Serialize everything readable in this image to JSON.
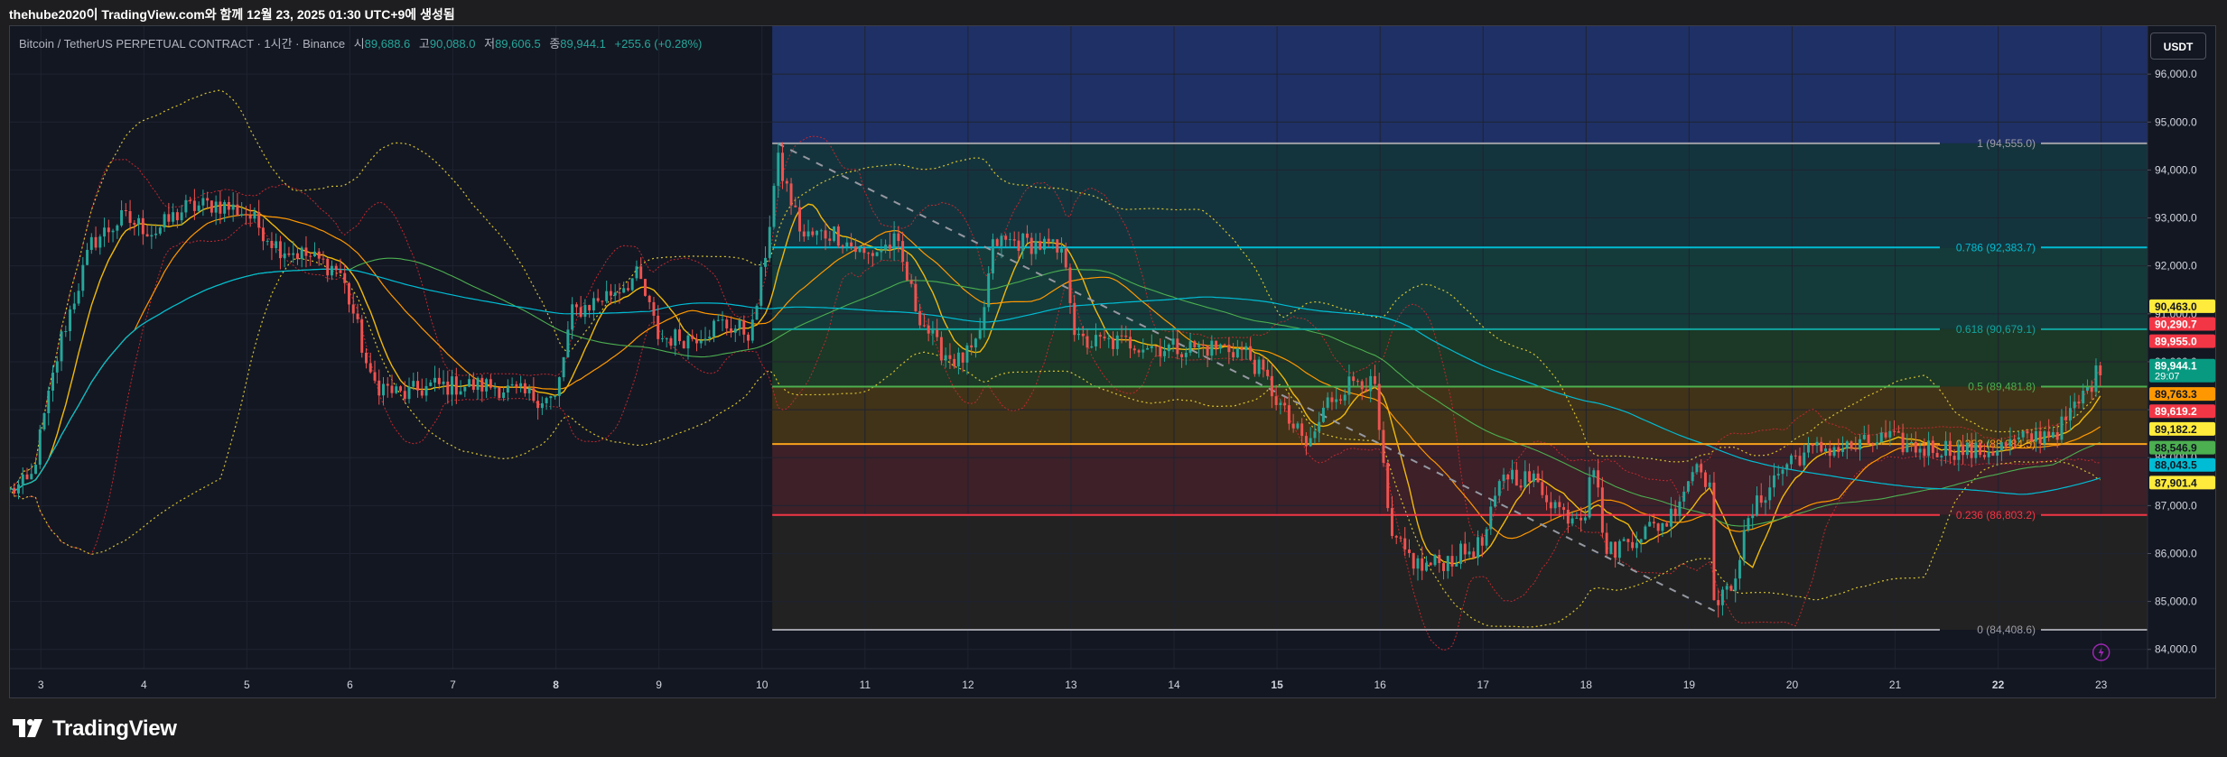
{
  "share_text": "thehube2020이 TradingView.com와 함께 12월 23, 2025 01:30 UTC+9에 생성됨",
  "symbol": {
    "title": "Bitcoin / TetherUS PERPETUAL CONTRACT · 1시간 · Binance",
    "open_label": "시",
    "open": "89,688.6",
    "high_label": "고",
    "high": "90,088.0",
    "low_label": "저",
    "low": "89,606.5",
    "close_label": "종",
    "close": "89,944.1",
    "change": "+255.6 (+0.28%)"
  },
  "currency_button": "USDT",
  "footer_brand": "TradingView",
  "colors": {
    "up": "#26a69a",
    "down": "#ef5350",
    "background": "#131722",
    "grid": "#1f2331"
  },
  "chart_data": {
    "type": "candlestick",
    "y_axis": {
      "min": 83600,
      "max": 97000,
      "ticks": [
        84000,
        85000,
        86000,
        87000,
        88000,
        89000,
        90000,
        91000,
        92000,
        93000,
        94000,
        95000,
        96000
      ],
      "tick_labels": [
        "84,000.0",
        "85,000.0",
        "86,000.0",
        "87,000.0",
        "88,000.0",
        "89,000.0",
        "90,000.0",
        "91,000.0",
        "92,000.0",
        "93,000.0",
        "94,000.0",
        "95,000.0",
        "96,000.0"
      ],
      "position": "right"
    },
    "x_axis": {
      "day_start": 2.7,
      "day_end": 23.45,
      "labels": [
        {
          "day": 3,
          "text": "3",
          "bold": false
        },
        {
          "day": 4,
          "text": "4",
          "bold": false
        },
        {
          "day": 5,
          "text": "5",
          "bold": false
        },
        {
          "day": 6,
          "text": "6",
          "bold": false
        },
        {
          "day": 7,
          "text": "7",
          "bold": false
        },
        {
          "day": 8,
          "text": "8",
          "bold": true
        },
        {
          "day": 9,
          "text": "9",
          "bold": false
        },
        {
          "day": 10,
          "text": "10",
          "bold": false
        },
        {
          "day": 11,
          "text": "11",
          "bold": false
        },
        {
          "day": 12,
          "text": "12",
          "bold": false
        },
        {
          "day": 13,
          "text": "13",
          "bold": false
        },
        {
          "day": 14,
          "text": "14",
          "bold": false
        },
        {
          "day": 15,
          "text": "15",
          "bold": true
        },
        {
          "day": 16,
          "text": "16",
          "bold": false
        },
        {
          "day": 17,
          "text": "17",
          "bold": false
        },
        {
          "day": 18,
          "text": "18",
          "bold": false
        },
        {
          "day": 19,
          "text": "19",
          "bold": false
        },
        {
          "day": 20,
          "text": "20",
          "bold": false
        },
        {
          "day": 21,
          "text": "21",
          "bold": false
        },
        {
          "day": 22,
          "text": "22",
          "bold": true
        },
        {
          "day": 23,
          "text": "23",
          "bold": false
        }
      ]
    },
    "price_path": [
      [
        2.7,
        87300
      ],
      [
        2.9,
        87500
      ],
      [
        3.2,
        90500
      ],
      [
        3.5,
        92500
      ],
      [
        3.8,
        93000
      ],
      [
        4.1,
        92700
      ],
      [
        4.4,
        93200
      ],
      [
        4.7,
        93300
      ],
      [
        5.0,
        93100
      ],
      [
        5.3,
        92400
      ],
      [
        5.6,
        92200
      ],
      [
        5.9,
        91900
      ],
      [
        6.05,
        90900
      ],
      [
        6.2,
        89600
      ],
      [
        6.5,
        89300
      ],
      [
        6.8,
        89500
      ],
      [
        7.1,
        89500
      ],
      [
        7.4,
        89500
      ],
      [
        7.7,
        89300
      ],
      [
        8.0,
        89200
      ],
      [
        8.15,
        91000
      ],
      [
        8.5,
        91400
      ],
      [
        8.8,
        91800
      ],
      [
        9.0,
        90500
      ],
      [
        9.3,
        90500
      ],
      [
        9.6,
        90800
      ],
      [
        9.9,
        90600
      ],
      [
        10.05,
        92500
      ],
      [
        10.15,
        94200
      ],
      [
        10.4,
        92600
      ],
      [
        10.7,
        92700
      ],
      [
        11.0,
        92200
      ],
      [
        11.3,
        92500
      ],
      [
        11.5,
        91100
      ],
      [
        11.7,
        90300
      ],
      [
        11.9,
        90000
      ],
      [
        12.1,
        90300
      ],
      [
        12.25,
        92500
      ],
      [
        12.5,
        92500
      ],
      [
        12.8,
        92400
      ],
      [
        12.95,
        92100
      ],
      [
        13.05,
        90400
      ],
      [
        13.3,
        90400
      ],
      [
        13.6,
        90400
      ],
      [
        13.9,
        90300
      ],
      [
        14.2,
        90300
      ],
      [
        14.5,
        90300
      ],
      [
        14.7,
        90200
      ],
      [
        14.9,
        89600
      ],
      [
        15.1,
        88800
      ],
      [
        15.3,
        88200
      ],
      [
        15.5,
        89200
      ],
      [
        15.8,
        89700
      ],
      [
        15.95,
        89400
      ],
      [
        16.1,
        86300
      ],
      [
        16.4,
        85700
      ],
      [
        16.7,
        85900
      ],
      [
        17.0,
        86200
      ],
      [
        17.2,
        87700
      ],
      [
        17.5,
        87500
      ],
      [
        17.8,
        86800
      ],
      [
        18.0,
        86900
      ],
      [
        18.05,
        88200
      ],
      [
        18.2,
        86000
      ],
      [
        18.5,
        86400
      ],
      [
        18.8,
        86700
      ],
      [
        19.0,
        87600
      ],
      [
        19.1,
        88000
      ],
      [
        19.2,
        87300
      ],
      [
        19.25,
        84800
      ],
      [
        19.4,
        85300
      ],
      [
        19.6,
        86800
      ],
      [
        19.8,
        87500
      ],
      [
        20.0,
        88000
      ],
      [
        20.3,
        88200
      ],
      [
        20.6,
        88200
      ],
      [
        20.9,
        88400
      ],
      [
        21.2,
        88200
      ],
      [
        21.5,
        88200
      ],
      [
        21.8,
        88100
      ],
      [
        22.0,
        88200
      ],
      [
        22.3,
        88400
      ],
      [
        22.6,
        88600
      ],
      [
        22.8,
        89200
      ],
      [
        23.0,
        89900
      ]
    ],
    "fib_retracement": {
      "start_day": 10.1,
      "end_day": 23.45,
      "levels": [
        {
          "ratio": "1",
          "price": 94555.0,
          "label": "1 (94,555.0)",
          "color": "#9e9ea6",
          "fill": "#2f3037"
        },
        {
          "ratio": "0.786",
          "price": 92383.7,
          "label": "0.786 (92,383.7)",
          "color": "#00bcd4",
          "fill": "#14343d"
        },
        {
          "ratio": "0.618",
          "price": 90679.1,
          "label": "0.618 (90,679.1)",
          "color": "#11a5a0",
          "fill": "#143b3a"
        },
        {
          "ratio": "0.5",
          "price": 89481.8,
          "label": "0.5 (89,481.8)",
          "color": "#4caf50",
          "fill": "#1c3826"
        },
        {
          "ratio": "0.382",
          "price": 88284.5,
          "label": "0.382 (88,284.5)",
          "color": "#f8a21b",
          "fill": "#413318"
        },
        {
          "ratio": "0.236",
          "price": 86803.2,
          "label": "0.236 (86,803.2)",
          "color": "#f23645",
          "fill": "#3d2028"
        },
        {
          "ratio": "0",
          "price": 84408.6,
          "label": "0 (84,408.6)",
          "color": "#9e9ea6",
          "fill": null
        }
      ],
      "upper_zone_fill": "#1f3066"
    },
    "price_tags": [
      {
        "text": "90,463.0",
        "price": 91150,
        "bg": "#ffeb3b",
        "fg": "#131722"
      },
      {
        "text": "90,290.7",
        "price": 90780,
        "bg": "#f23645",
        "fg": "#ffffff"
      },
      {
        "text": "89,955.0",
        "price": 90420,
        "bg": "#f23645",
        "fg": "#ffffff"
      },
      {
        "text": "89,944.1",
        "text2": "29:07",
        "price": 89910,
        "bg": "#089981",
        "fg": "#ffffff"
      },
      {
        "text": "89,763.3",
        "price": 89320,
        "bg": "#ff9800",
        "fg": "#131722"
      },
      {
        "text": "89,619.2",
        "price": 88960,
        "bg": "#f23645",
        "fg": "#ffffff"
      },
      {
        "text": "89,182.2",
        "price": 88590,
        "bg": "#ffeb3b",
        "fg": "#131722"
      },
      {
        "text": "88,546.9",
        "price": 88200,
        "bg": "#4caf50",
        "fg": "#131722"
      },
      {
        "text": "88,043.5",
        "price": 87840,
        "bg": "#00bcd4",
        "fg": "#131722"
      },
      {
        "text": "87,901.4",
        "price": 87470,
        "bg": "#ffeb3b",
        "fg": "#131722"
      }
    ]
  }
}
